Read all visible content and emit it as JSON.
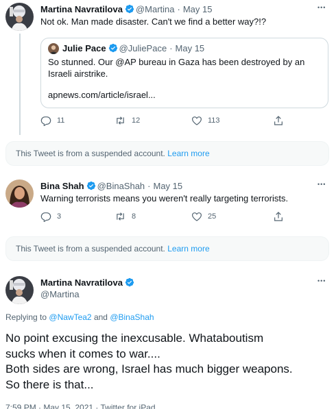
{
  "tweet1": {
    "name": "Martina Navratilova",
    "handle": "@Martina",
    "sep": "·",
    "date": "May 15",
    "text": "Not ok. Man made disaster. Can't we find a better way?!?",
    "more": "•••",
    "quote": {
      "name": "Julie Pace",
      "handle": "@JuliePace",
      "sep": "·",
      "date": "May 15",
      "text": "So stunned. Our @AP bureau in Gaza has been destroyed by an Israeli airstrike.",
      "link": "apnews.com/article/israel..."
    },
    "replies": "11",
    "retweets": "12",
    "likes": "113"
  },
  "suspended1": {
    "text": "This Tweet is from a suspended account.",
    "link": "Learn more"
  },
  "tweet2": {
    "name": "Bina Shah",
    "handle": "@BinaShah",
    "sep": "·",
    "date": "May 15",
    "text": "Warning terrorists means you weren't really targeting terrorists.",
    "more": "•••",
    "replies": "3",
    "retweets": "8",
    "likes": "25"
  },
  "suspended2": {
    "text": "This Tweet is from a suspended account.",
    "link": "Learn more"
  },
  "main_tweet": {
    "name": "Martina Navratilova",
    "handle": "@Martina",
    "more": "•••",
    "replying_prefix": "Replying to",
    "replying_user1": "@NawTea2",
    "replying_and": "and",
    "replying_user2": "@BinaShah",
    "text_line1": "No point excusing the inexcusable. Whataboutism",
    "text_line2": "sucks when it comes to war....",
    "text_line3": "Both sides are wrong, Israel has much bigger weapons.",
    "text_line4": "So there is that...",
    "footer": "7:59 PM · May 15, 2021 · Twitter for iPad"
  },
  "colors": {
    "accent": "#1d9bf0",
    "muted": "#536471",
    "border": "#cfd9de"
  },
  "icons": [
    "verified-badge-icon",
    "reply-icon",
    "retweet-icon",
    "like-icon",
    "share-icon",
    "more-icon"
  ]
}
